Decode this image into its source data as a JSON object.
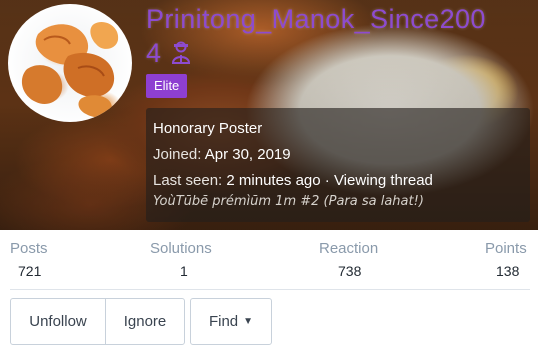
{
  "profile": {
    "username": "Prinitong_Manok_Since2004",
    "username_line1": "Prinitong_Manok_Since200",
    "username_line2": "4",
    "badge": "Elite",
    "title": "Honorary Poster",
    "joined_label": "Joined:",
    "joined_value": "Apr 30, 2019",
    "last_seen_label": "Last seen:",
    "last_seen_value": "2 minutes ago · Viewing thread",
    "signature": "YoùTūbē prémìūm 1m #2 (Para sa lahat!)"
  },
  "stats": [
    {
      "label": "Posts",
      "value": "721"
    },
    {
      "label": "Solutions",
      "value": "1"
    },
    {
      "label": "Reaction",
      "value": "738"
    },
    {
      "label": "Points",
      "value": "138"
    }
  ],
  "actions": {
    "unfollow": "Unfollow",
    "ignore": "Ignore",
    "find": "Find"
  },
  "icons": {
    "user_icon": "user-shield-icon",
    "find_caret": "caret-down-icon"
  },
  "colors": {
    "username": "#8d4bcf",
    "badge_bg": "#8e3fd1",
    "stat_label": "#8a9aab",
    "button_border": "#c8d1db"
  }
}
